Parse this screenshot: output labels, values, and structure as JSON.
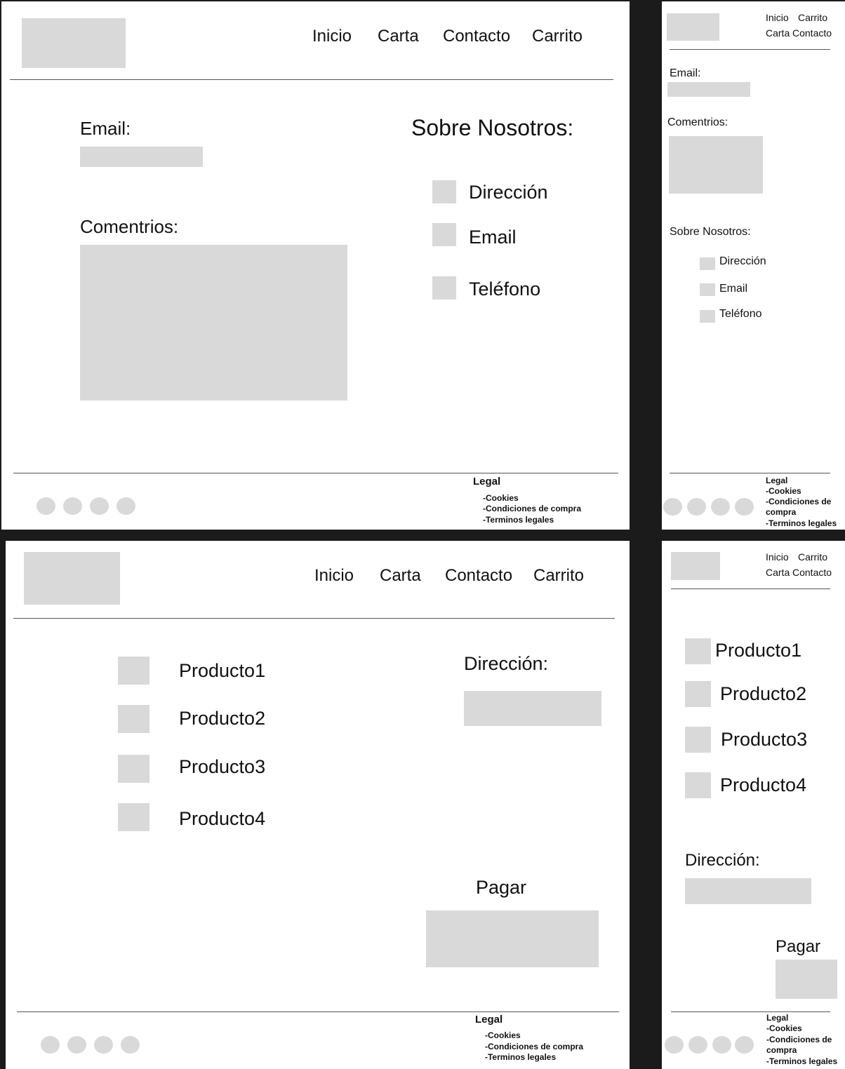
{
  "nav": {
    "inicio": "Inicio",
    "carta": "Carta",
    "contacto": "Contacto",
    "carrito": "Carrito"
  },
  "contact": {
    "email_label": "Email:",
    "comments_label": "Comentrios:",
    "about_title": "Sobre Nosotros:",
    "about_items": [
      "Dirección",
      "Email",
      "Teléfono"
    ]
  },
  "cart": {
    "products": [
      "Producto1",
      "Producto2",
      "Producto3",
      "Producto4"
    ],
    "address_label": "Dirección:",
    "pay_label": "Pagar"
  },
  "footer": {
    "legal_title": "Legal",
    "items": [
      "-Cookies",
      "-Condiciones de compra",
      "-Terminos  legales"
    ],
    "mobile_items": [
      "-Cookies",
      "-Condiciones de",
      "compra",
      "-Terminos  legales"
    ]
  },
  "colors": {
    "placeholder": "#d9d9d9",
    "divider": "#1b1b1b",
    "background": "#ffffff"
  }
}
